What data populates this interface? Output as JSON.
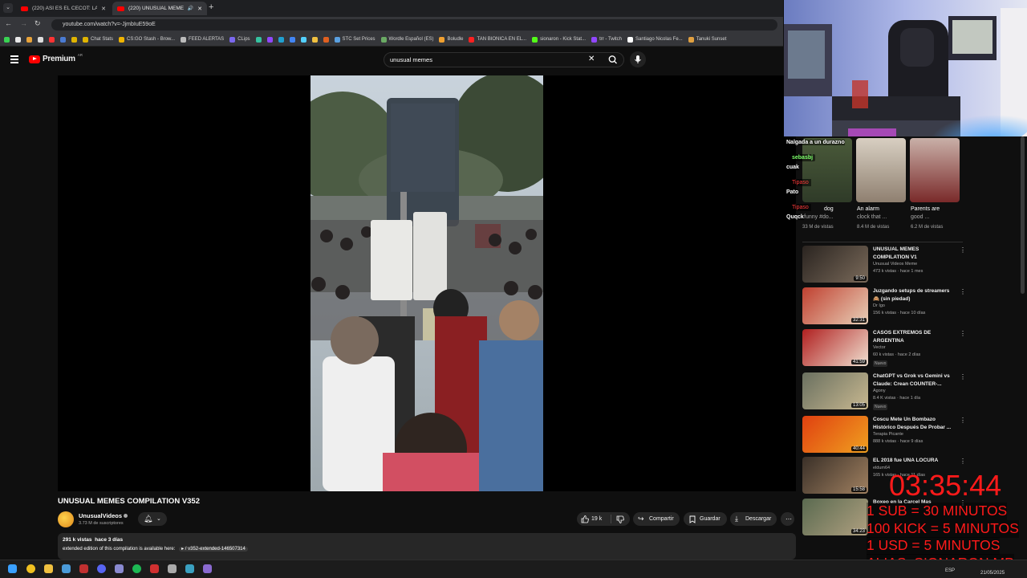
{
  "browser": {
    "tabs": [
      {
        "title": "(220) ASÍ ES EL CECOT: LA CÁR",
        "active": false
      },
      {
        "title": "(220) UNUSUAL MEMES CO",
        "active": true
      }
    ],
    "url": "youtube.com/watch?v=-JjmbIuE59oE",
    "bookmarks": [
      {
        "label": "",
        "color": "#39d353"
      },
      {
        "label": "",
        "color": "#e8e8e8"
      },
      {
        "label": "",
        "color": "#e8a33a"
      },
      {
        "label": "",
        "color": "#dddddd"
      },
      {
        "label": "",
        "color": "#ff3333"
      },
      {
        "label": "",
        "color": "#4a7bd3"
      },
      {
        "label": "",
        "color": "#e0b400"
      },
      {
        "label": "Chat Stats",
        "color": "#e0b400"
      },
      {
        "label": "CS:GO Stash - Brow...",
        "color": "#f0b400"
      },
      {
        "label": "FEED ALERTAS",
        "color": "#bbbbbb"
      },
      {
        "label": "CLips",
        "color": "#7b68ee"
      },
      {
        "label": "",
        "color": "#35c2a0"
      },
      {
        "label": "",
        "color": "#9147ff"
      },
      {
        "label": "",
        "color": "#20a0d0"
      },
      {
        "label": "",
        "color": "#4285f4"
      },
      {
        "label": "",
        "color": "#53d0ff"
      },
      {
        "label": "",
        "color": "#f0c040"
      },
      {
        "label": "",
        "color": "#e06020"
      },
      {
        "label": "STC Set Prices",
        "color": "#5aa0e0"
      },
      {
        "label": "Wordle Español (ES)",
        "color": "#6aaa64"
      },
      {
        "label": "Boludle",
        "color": "#f0a030"
      },
      {
        "label": "TAN BIONICA EN EL...",
        "color": "#ff2020"
      },
      {
        "label": "sionaron - Kick Stat...",
        "color": "#53fc18"
      },
      {
        "label": "trr - Twitch",
        "color": "#9147ff"
      },
      {
        "label": "Santiago Nicolas Fe...",
        "color": "#ffffff"
      },
      {
        "label": "Tanuki Sunset",
        "color": "#e0a040"
      }
    ]
  },
  "youtube": {
    "logo_label": "Premium",
    "region_code": "AR",
    "search": {
      "value": "unusual memes"
    },
    "video": {
      "title": "UNUSUAL MEMES COMPILATION V352",
      "channel": "UnusualVideos",
      "subscribers": "3.73 M de suscriptores",
      "likes": "19 k",
      "share_label": "Compartir",
      "save_label": "Guardar",
      "download_label": "Descargar",
      "views_date": "291 k vistas  hace 3 días",
      "description": "extended edition of this compilation is available here:",
      "description_link": "/ v352-extended-146507314"
    },
    "shorts": [
      {
        "title": "dog",
        "title2": "funny #do...",
        "views": "33 M de vistas"
      },
      {
        "title": "An alarm",
        "title2": "clock that ...",
        "views": "8.4 M de vistas"
      },
      {
        "title": "Parents are",
        "title2": "good ...",
        "views": "6.2 M de vistas"
      }
    ],
    "recommendations": [
      {
        "title": "UNUSUAL MEMES COMPILATION V1",
        "channel": "Unusual Videos Meme",
        "meta": "473 k vistas · hace 1 mes",
        "duration": "9:50",
        "badge": ""
      },
      {
        "title": "Juzgando setups de streamers 🙈 (sin piedad)",
        "channel": "Dr Igo",
        "meta": "156 k vistas · hace 10 días",
        "duration": "32:31",
        "badge": ""
      },
      {
        "title": "CASOS EXTREMOS DE ARGENTINA",
        "channel": "Vector",
        "meta": "60 k vistas · hace 2 días",
        "duration": "41:59",
        "badge": "Nuevo"
      },
      {
        "title": "ChatGPT vs Grok vs Gemini vs Claude: Crean COUNTER-...",
        "channel": "Agony",
        "meta": "8.4 K vistas · hace 1 día",
        "duration": "13:05",
        "badge": "Nuevo"
      },
      {
        "title": "Coscu Mete Un Bombazo Histórico Después De Probar ...",
        "channel": "Terapia Picante",
        "meta": "888 k vistas · hace 9 días",
        "duration": "40:44",
        "badge": ""
      },
      {
        "title": "EL 2018 fue UNA LOCURA",
        "channel": "eldum64",
        "meta": "165 k vistas · hace 11 días",
        "duration": "15:58",
        "badge": ""
      },
      {
        "title": "Boxeo en la Carcel Mas",
        "channel": "",
        "meta": "",
        "duration": "34:23",
        "badge": ""
      }
    ]
  },
  "stream": {
    "chat": [
      {
        "user": "Nalgada a un durazno",
        "kind": "plain"
      },
      {
        "user": "sebasbj",
        "kind": "green"
      },
      {
        "user": "cuak",
        "kind": "plain"
      },
      {
        "user": "Tipaso",
        "kind": "red"
      },
      {
        "user": "Pato",
        "kind": "plain"
      },
      {
        "user": "Tipaso",
        "kind": "red"
      },
      {
        "user": "Quqck",
        "kind": "plain"
      }
    ],
    "timer": "03:35:44",
    "rules": [
      "1 SUB = 30 MINUTOS",
      "100 KICK = 5 MINUTOS",
      "1 USD = 5 MINUTOS",
      "ALIAS: SIONARON.MP"
    ],
    "clock": "21/05/2025",
    "lang": "ESP"
  },
  "icons": [
    "menu-icon",
    "youtube-logo-icon",
    "search-icon",
    "clear-icon",
    "mic-icon",
    "bell-icon",
    "like-icon",
    "dislike-icon",
    "share-icon",
    "save-icon",
    "download-icon",
    "more-icon",
    "windows-start-icon",
    "chrome-icon",
    "folder-icon",
    "steam-icon",
    "discord-icon",
    "spotify-icon"
  ],
  "colors": {
    "youtube_red": "#ff0000",
    "overlay_red": "#ff1a1a",
    "background": "#0f0f0f"
  }
}
